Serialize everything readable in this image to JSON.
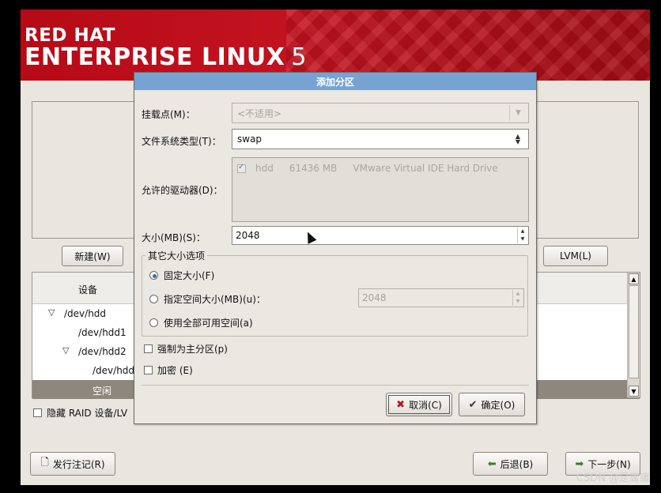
{
  "banner": {
    "line1": "RED HAT",
    "line2": "ENTERPRISE LINUX",
    "version": "5"
  },
  "background": {
    "new_button": "新建(W)",
    "lvm_button": "LVM(L)",
    "tree_header_device": "设备",
    "tree_rows": [
      "/dev/hdd",
      "/dev/hdd1",
      "/dev/hdd2",
      "/dev/hdd",
      "空闲"
    ],
    "hide_raid_label": "隐藏 RAID 设备/LV",
    "release_notes_button": "发行注记(R)",
    "back_button": "后退(B)",
    "next_button": "下一步(N)"
  },
  "dialog": {
    "title": "添加分区",
    "mount_point_label": "挂载点(M)：",
    "mount_point_value": "<不适用>",
    "fs_type_label": "文件系统类型(T)：",
    "fs_type_value": "swap",
    "drives_label": "允许的驱动器(D)：",
    "drive": {
      "name": "hdd",
      "size": "61436 MB",
      "model": "VMware Virtual IDE Hard Drive",
      "checked": true
    },
    "size_label": "大小(MB)(S)：",
    "size_value": "2048",
    "other_size_group": "其它大小选项",
    "options": {
      "fixed": "固定大小(F)",
      "fill_to": "指定空间大小(MB)(u)：",
      "fill_to_value": "2048",
      "fill_all": "使用全部可用空间(a)",
      "selected": "fixed"
    },
    "force_primary_label": "强制为主分区(p)",
    "encrypt_label": "加密 (E)",
    "cancel_button": "取消(C)",
    "ok_button": "确定(O)"
  },
  "watermark": "CSDN @是庸庸"
}
